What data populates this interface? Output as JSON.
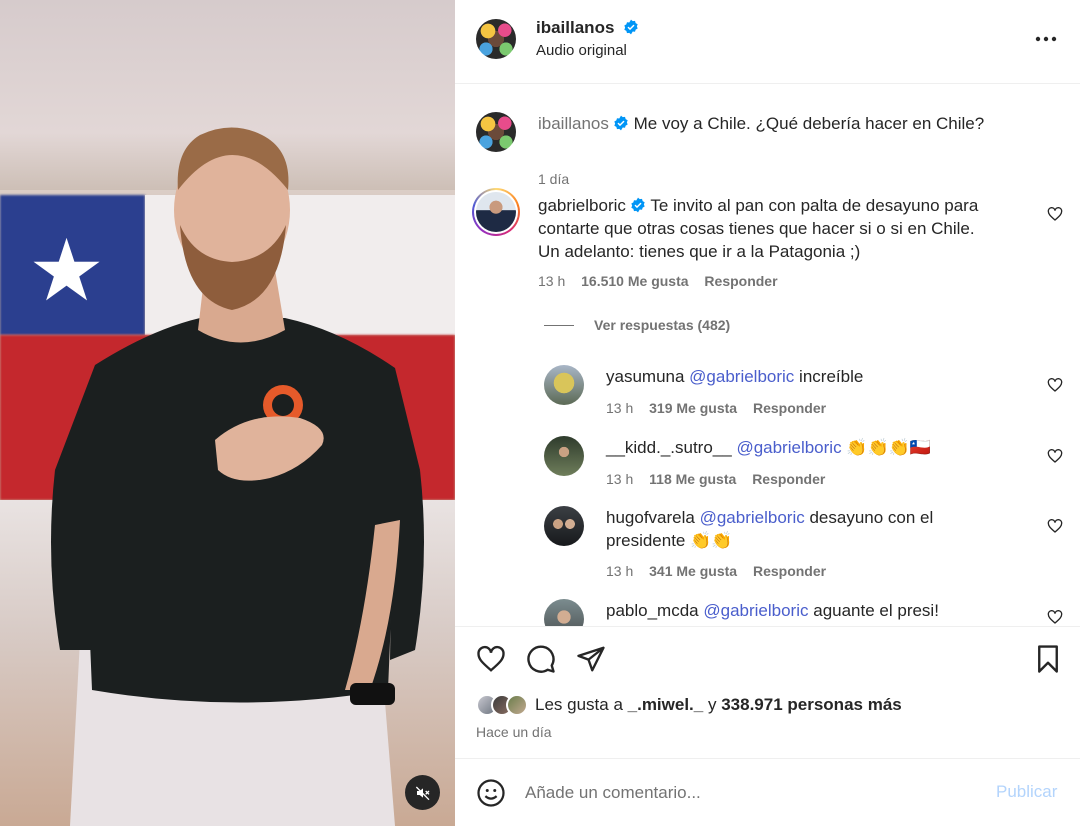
{
  "header": {
    "username": "ibaillanos",
    "subtitle": "Audio original"
  },
  "caption": {
    "username": "ibaillanos",
    "text": "Me voy a Chile. ¿Qué debería hacer en Chile?",
    "time": "1 día"
  },
  "top_comment": {
    "username": "gabrielboric",
    "line1": "Te invito al pan con palta de desayuno para",
    "line2": "contarte que otras cosas tienes que hacer si o si en Chile.",
    "line3": "Un adelanto: tienes que ir a la Patagonia ;)",
    "time": "13 h",
    "likes": "16.510 Me gusta",
    "reply": "Responder"
  },
  "view_replies": "Ver respuestas (482)",
  "replies": [
    {
      "username": "yasumuna",
      "mention": "@gabrielboric",
      "text": "increíble",
      "time": "13 h",
      "likes": "319 Me gusta",
      "reply": "Responder"
    },
    {
      "username": "__kidd._.sutro__",
      "mention": "@gabrielboric",
      "text": "👏👏👏🇨🇱",
      "time": "13 h",
      "likes": "118 Me gusta",
      "reply": "Responder"
    },
    {
      "username": "hugofvarela",
      "mention": "@gabrielboric",
      "text": "desayuno con el",
      "text2": "presidente 👏👏",
      "time": "13 h",
      "likes": "341 Me gusta",
      "reply": "Responder"
    },
    {
      "username": "pablo_mcda",
      "mention": "@gabrielboric",
      "text": "aguante el presi!"
    }
  ],
  "likes": {
    "prefix": "Les gusta a",
    "user": "_.miwel._",
    "joiner": "y",
    "rest": "338.971 personas más",
    "time_ago": "Hace un día"
  },
  "composer": {
    "placeholder": "Añade un comentario...",
    "publish": "Publicar"
  },
  "icons": {
    "verified": "verified-badge-icon",
    "more": "more-options-icon",
    "like": "heart-icon",
    "comment": "comment-icon",
    "share": "send-icon",
    "save": "bookmark-icon",
    "emoji": "emoji-icon",
    "mute": "muted-speaker-icon"
  },
  "colors": {
    "verified": "#0095f6",
    "mention": "#4a5ecc",
    "publish_disabled": "#b3d4fc"
  }
}
